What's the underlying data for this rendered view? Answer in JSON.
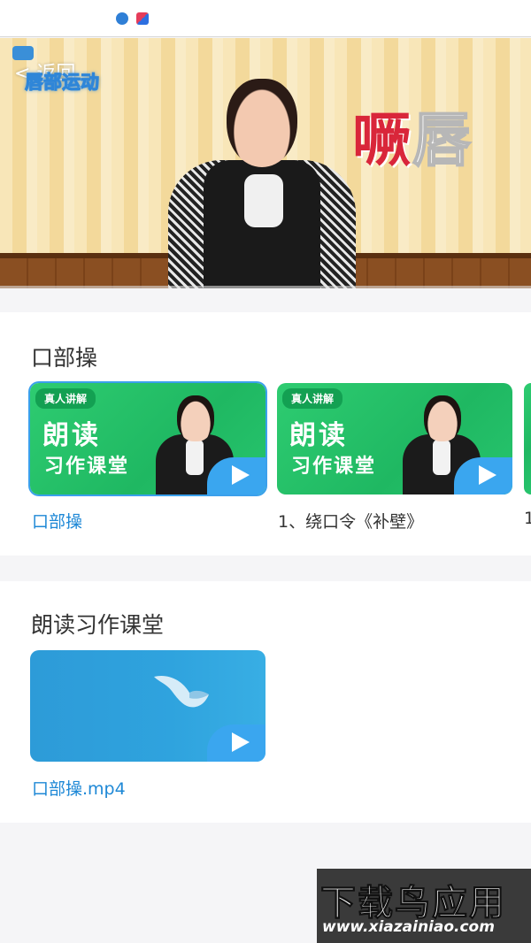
{
  "player": {
    "back_label": "< 返回",
    "video_title": "唇部运动",
    "caption_part1": "噘",
    "caption_part2": "唇"
  },
  "section1": {
    "title": "口部操",
    "cards": [
      {
        "tag": "真人讲解",
        "line1": "朗读",
        "line2": "习作课堂",
        "label": "口部操",
        "selected": true
      },
      {
        "tag": "真人讲解",
        "line1": "朗读",
        "line2": "习作课堂",
        "label": "1、绕口令《补壁》",
        "selected": false
      },
      {
        "label": "1"
      }
    ]
  },
  "section2": {
    "title": "朗读习作课堂",
    "cards": [
      {
        "label": "口部操.mp4"
      }
    ]
  },
  "watermark": {
    "text": "下载鸟应用",
    "url": "www.xiazainiao.com"
  },
  "colors": {
    "accent_blue": "#2f86d8",
    "selected_label": "#1e88d6",
    "card_green": "#2ecc71",
    "card_blue": "#2fa3de"
  }
}
